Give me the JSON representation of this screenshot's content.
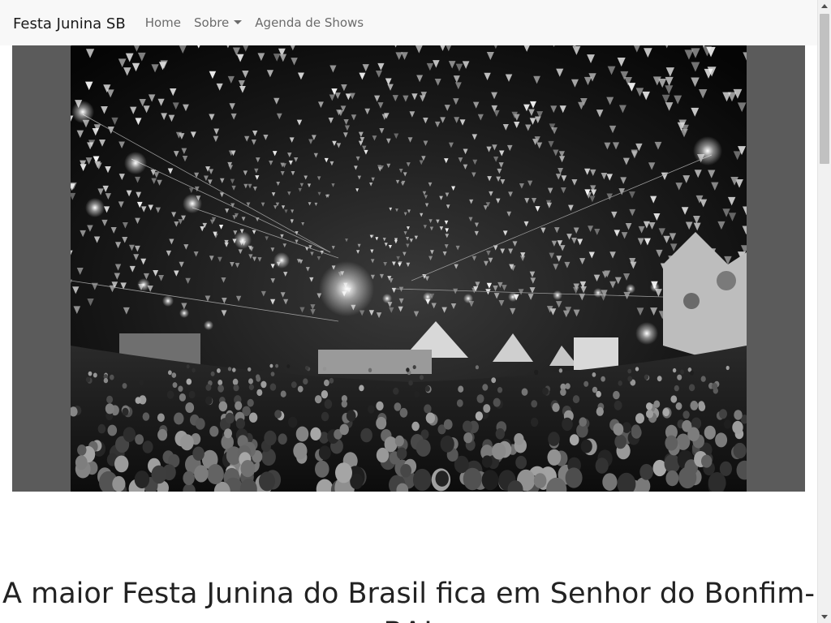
{
  "navbar": {
    "brand": "Festa Junina SB",
    "links": [
      {
        "label": "Home"
      },
      {
        "label": "Sobre",
        "dropdown": true
      },
      {
        "label": "Agenda de Shows"
      }
    ]
  },
  "hero": {
    "image_alt": "Festa junina crowd under colorful flag canopy (black and white)"
  },
  "headline": "A maior Festa Junina do Brasil fica em Senhor do Bonfim-BA!",
  "colors": {
    "navbar_bg": "#f8f8f8",
    "hero_letterbox": "#5b5b5b",
    "headline_text": "#222222"
  },
  "icons": {
    "dropdown": "caret-down-icon",
    "scroll_up": "arrow-up-icon",
    "scroll_down": "arrow-down-icon"
  }
}
